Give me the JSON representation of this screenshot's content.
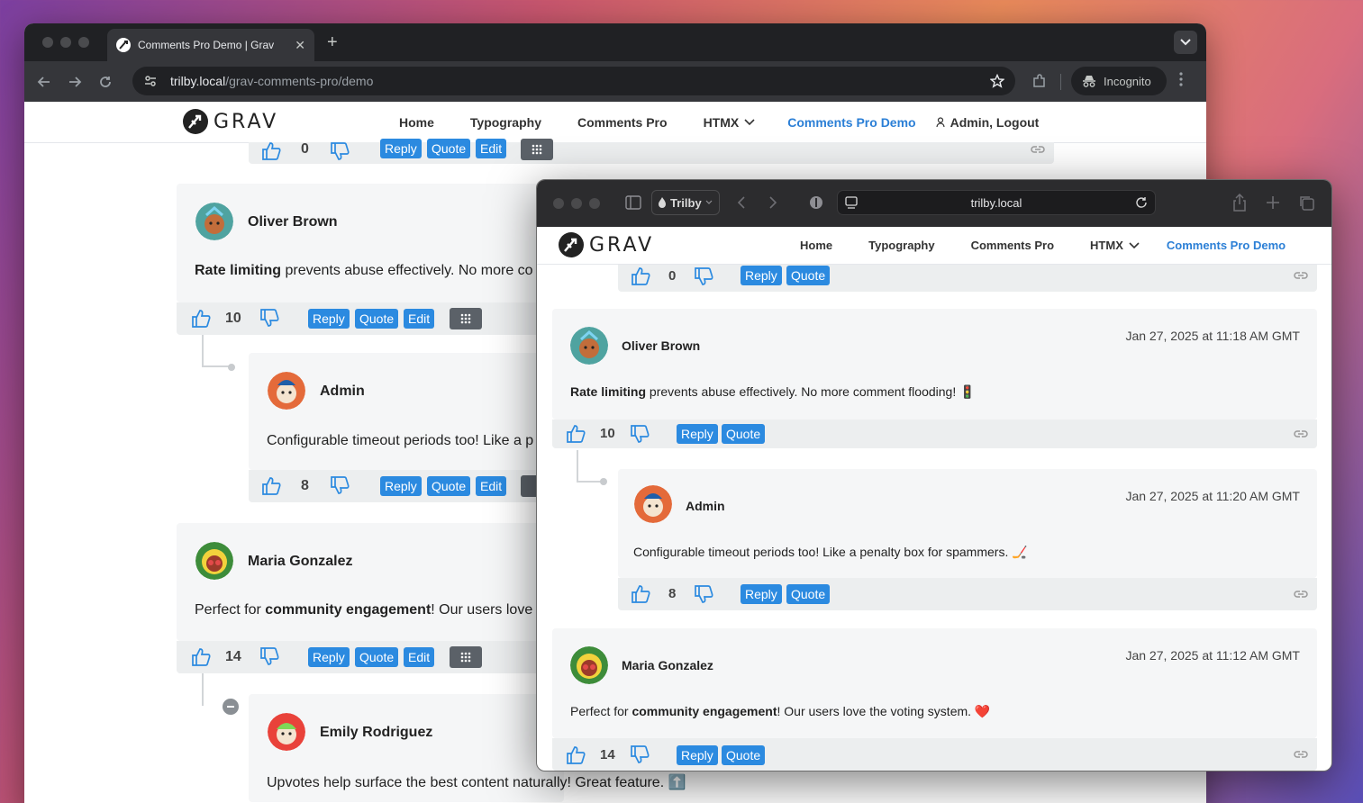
{
  "chrome": {
    "tab_title": "Comments Pro Demo | Grav",
    "url_host": "trilby.local",
    "url_path": "/grav-comments-pro/demo",
    "incognito_label": "Incognito"
  },
  "safari": {
    "profile_label": "Trilby",
    "address": "trilby.local"
  },
  "site": {
    "logo_text": "GRAV",
    "nav": [
      {
        "label": "Home"
      },
      {
        "label": "Typography"
      },
      {
        "label": "Comments Pro"
      },
      {
        "label": "HTMX"
      },
      {
        "label": "Comments Pro Demo"
      }
    ],
    "user_label": "Admin, Logout"
  },
  "buttons": {
    "reply": "Reply",
    "quote": "Quote",
    "edit": "Edit"
  },
  "comments": [
    {
      "author": "Oliver Brown",
      "body_bold": "Rate limiting",
      "body_rest": " prevents abuse effectively. No more comment flooding! 🚦",
      "chrome_body_rest": " prevents abuse effectively. No more co",
      "votes": "10",
      "date": "Jan 27, 2025 at 11:18 AM GMT"
    },
    {
      "author": "Admin",
      "body": "Configurable timeout periods too! Like a penalty box for spammers. 🏒",
      "chrome_body": "Configurable timeout periods too! Like a p",
      "votes": "8",
      "date": "Jan 27, 2025 at 11:20 AM GMT"
    },
    {
      "author": "Maria Gonzalez",
      "body_pre": "Perfect for ",
      "body_bold": "community engagement",
      "body_rest": "! Our users love the voting system. ❤️",
      "chrome_body_rest": "! Our users love",
      "votes": "14",
      "date": "Jan 27, 2025 at 11:12 AM GMT"
    },
    {
      "author": "Emily Rodriguez",
      "body": "Upvotes help surface the best content naturally! Great feature. ⬆️"
    }
  ],
  "top_partial_votes": "0",
  "colors": {
    "accent": "#2b8ae0",
    "active_nav": "#2b7fd6",
    "card_bg": "#f5f6f7"
  }
}
